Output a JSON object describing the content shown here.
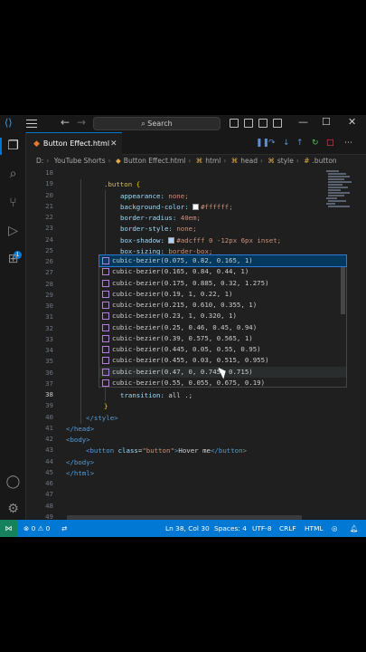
{
  "titlebar": {
    "search_label": "Search",
    "search_icon": "magnifier-icon",
    "back_glyph": "←",
    "forward_glyph": "→",
    "minimize_glyph": "—",
    "maximize_glyph": "☐",
    "close_glyph": "✕"
  },
  "tab": {
    "label": "Button Effect.html",
    "close_glyph": "✕"
  },
  "breadcrumb": {
    "drive": "D:",
    "folder": "YouTube Shorts",
    "file": "Button Effect.html",
    "n1": "html",
    "n2": "head",
    "n3": "style",
    "n4": ".button"
  },
  "editor": {
    "line_numbers": [
      "18",
      "19",
      "20",
      "21",
      "22",
      "23",
      "24",
      "25",
      "26",
      "27",
      "28",
      "29",
      "30",
      "31",
      "32",
      "33",
      "34",
      "35",
      "36",
      "37",
      "38",
      "39",
      "40",
      "41",
      "42",
      "43",
      "44",
      "45",
      "46",
      "47",
      "48",
      "49"
    ],
    "current_line": "38",
    "lines": {
      "l19_sel": ".button",
      "l19_brace": "{",
      "l20_prop": "appearance:",
      "l20_val": "none;",
      "l21_prop": "background-color:",
      "l21_val": "#ffffff;",
      "l22_prop": "border-radius:",
      "l22_val": "40em;",
      "l23_prop": "border-style:",
      "l23_val": "none;",
      "l24_prop": "box-shadow:",
      "l24_val": "#adcfff 0 -12px 6px inset;",
      "l25_prop": "box-sizing:",
      "l25_val": "border-box;",
      "l38_prop": "transition:",
      "l38_val": "all .;",
      "l39_brace": "}",
      "l40": "</style>",
      "l41": "</head>",
      "l42": "<body>",
      "l43_open": "<button",
      "l43_attr": "class",
      "l43_eq": "=",
      "l43_str": "\"button\"",
      "l43_gt": ">",
      "l43_text": "Hover me",
      "l43_close": "</button>",
      "l44": "</body>",
      "l45": "</html>"
    },
    "swatch_colors": {
      "l21": "#ffffff",
      "l24": "#adcfff"
    }
  },
  "suggestions": [
    "cubic-bezier(0.075, 0.82, 0.165, 1)",
    "cubic-bezier(0.165, 0.84, 0.44, 1)",
    "cubic-bezier(0.175, 0.885, 0.32, 1.275)",
    "cubic-bezier(0.19, 1, 0.22, 1)",
    "cubic-bezier(0.215, 0.610, 0.355, 1)",
    "cubic-bezier(0.23, 1, 0.320, 1)",
    "cubic-bezier(0.25, 0.46, 0.45, 0.94)",
    "cubic-bezier(0.39, 0.575, 0.565, 1)",
    "cubic-bezier(0.445, 0.05, 0.55, 0.95)",
    "cubic-bezier(0.455, 0.03, 0.515, 0.955)",
    "cubic-bezier(0.47, 0, 0.745, 0.715)",
    "cubic-bezier(0.55, 0.055, 0.675, 0.19)"
  ],
  "statusbar": {
    "errors": "0",
    "warnings": "0",
    "position": "Ln 38, Col 30",
    "spaces": "Spaces: 4",
    "encoding": "UTF-8",
    "eol": "CRLF",
    "language": "HTML"
  },
  "colors": {
    "accent": "#0078d4",
    "editor_bg": "#1f1f1f",
    "chrome_bg": "#181818",
    "remote": "#16825d"
  }
}
